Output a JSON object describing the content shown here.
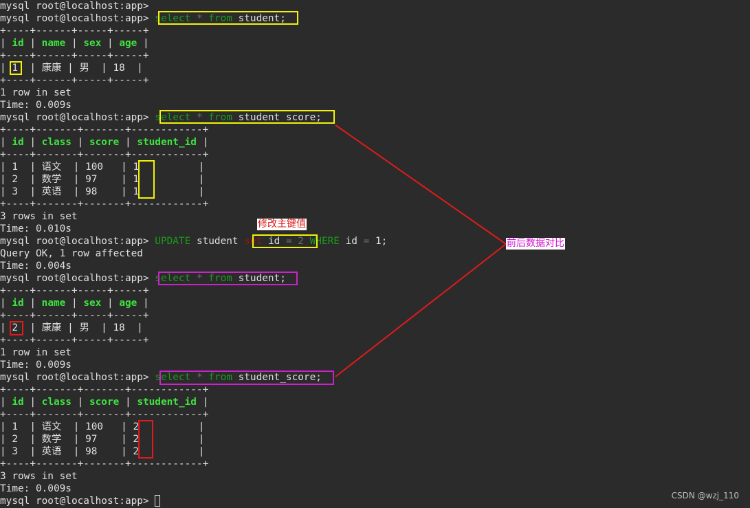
{
  "prompt": "mysql root@localhost:app>",
  "kw": {
    "select": "select",
    "star": "*",
    "from": "from",
    "update": "UPDATE",
    "set": "set",
    "where": "WHERE",
    "eq": "="
  },
  "tables": {
    "student": "student;",
    "student_score": "student_score;"
  },
  "borders": {
    "student": "+----+------+-----+-----+",
    "score": "+----+-------+-------+------------+"
  },
  "student_headers": {
    "id": "id",
    "name": "name",
    "sex": "sex",
    "age": "age"
  },
  "score_headers": {
    "id": "id",
    "class": "class",
    "score": "score",
    "student_id": "student_id"
  },
  "student_before": {
    "id": "1",
    "name": "康康",
    "sex": "男",
    "age": "18"
  },
  "student_after": {
    "id": "2",
    "name": "康康",
    "sex": "男",
    "age": "18"
  },
  "score_before": [
    {
      "id": "1",
      "class": "语文",
      "score": "100",
      "student_id": "1"
    },
    {
      "id": "2",
      "class": "数学",
      "score": "97",
      "student_id": "1"
    },
    {
      "id": "3",
      "class": "英语",
      "score": "98",
      "student_id": "1"
    }
  ],
  "score_after": [
    {
      "id": "1",
      "class": "语文",
      "score": "100",
      "student_id": "2"
    },
    {
      "id": "2",
      "class": "数学",
      "score": "97",
      "student_id": "2"
    },
    {
      "id": "3",
      "class": "英语",
      "score": "98",
      "student_id": "2"
    }
  ],
  "update": {
    "table": "student",
    "col": "id",
    "new_value": "2",
    "where_col": "id",
    "old_value": "1;"
  },
  "results": {
    "one_row": "1 row in set",
    "three_rows": "3 rows in set",
    "t1": "Time: 0.009s",
    "t2": "Time: 0.010s",
    "t3": "Time: 0.004s",
    "t4": "Time: 0.009s",
    "t5": "Time: 0.009s",
    "query_ok": "Query OK, 1 row affected"
  },
  "first_line": "mysql root@localhost:app>",
  "annotations": {
    "modify_pk": "修改主键值",
    "compare": "前后数据对比"
  },
  "watermark": "CSDN @wzj_110",
  "colors": {
    "background": "#2b2b2b",
    "keyword": "#1b9a1b",
    "header": "#3fe33f",
    "highlight_yellow": "#f2f20a",
    "highlight_red": "#e01b1b",
    "highlight_magenta": "#cc22cc"
  }
}
